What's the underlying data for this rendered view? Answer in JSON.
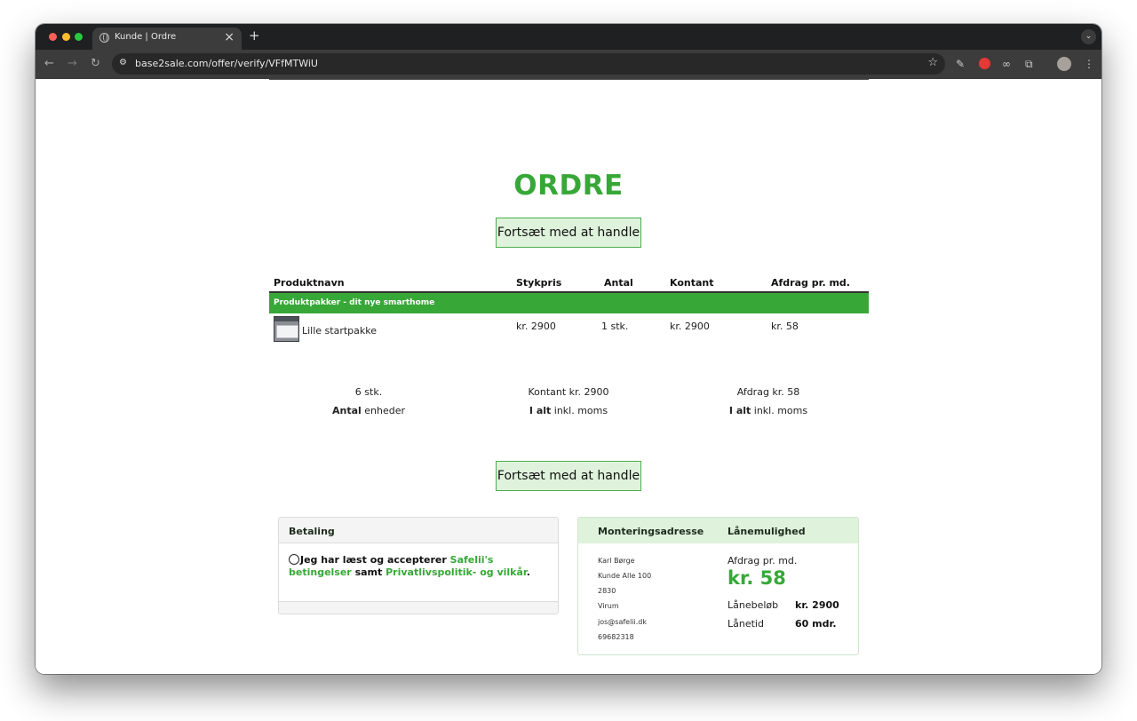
{
  "browser": {
    "tab_title": "Kunde | Ordre",
    "url": "base2sale.com/offer/verify/VFfMTWiU",
    "traffic_colors": [
      "#ff5f57",
      "#febc2e",
      "#28c840"
    ],
    "icons": {
      "close": "×",
      "new_tab": "+",
      "tab_menu": "⌄",
      "back": "←",
      "forward": "→",
      "reload": "↻",
      "site_info": "⚙",
      "star": "☆",
      "dropper": "✎",
      "shield": "⬤",
      "glasses": "∞",
      "puzzle": "⧉",
      "menu": "⋮"
    }
  },
  "page": {
    "title": "ORDRE",
    "continue_label": "Fortsæt med at handle",
    "accent_color": "#37a837"
  },
  "table": {
    "headers": [
      "Produktnavn",
      "Stykpris",
      "Antal",
      "Kontant",
      "Afdrag pr. md."
    ],
    "category": "Produktpakker - dit nye smarthome",
    "row": {
      "name": "Lille startpakke",
      "unit_price": "kr. 2900",
      "qty": "1 stk.",
      "cash": "kr. 2900",
      "monthly": "kr. 58"
    }
  },
  "summary": {
    "units_value": "6 stk.",
    "units_label_bold": "Antal",
    "units_label_rest": "enheder",
    "cash_value": "Kontant kr. 2900",
    "cash_label_bold": "I alt",
    "cash_label_rest": "inkl. moms",
    "monthly_value": "Afdrag kr. 58",
    "monthly_label_bold": "I alt",
    "monthly_label_rest": "inkl. moms"
  },
  "payment": {
    "title": "Betaling",
    "terms_prefix": "Jeg har læst og accepterer",
    "terms_link1": "Safelii's betingelser",
    "terms_mid": "samt",
    "terms_link2": "Privatlivspolitik- og vilkår",
    "terms_suffix": "."
  },
  "mounting": {
    "title": "Monteringsadresse",
    "lines": [
      "Karl Børge",
      "Kunde Alle 100",
      "2830",
      "Virum",
      "jos@safelii.dk",
      "69682318"
    ]
  },
  "loan": {
    "title": "Lånemulighed",
    "monthly_label": "Afdrag pr. md.",
    "monthly_value": "kr. 58",
    "amount_label": "Lånebeløb",
    "amount_value": "kr. 2900",
    "term_label": "Lånetid",
    "term_value": "60 mdr."
  }
}
